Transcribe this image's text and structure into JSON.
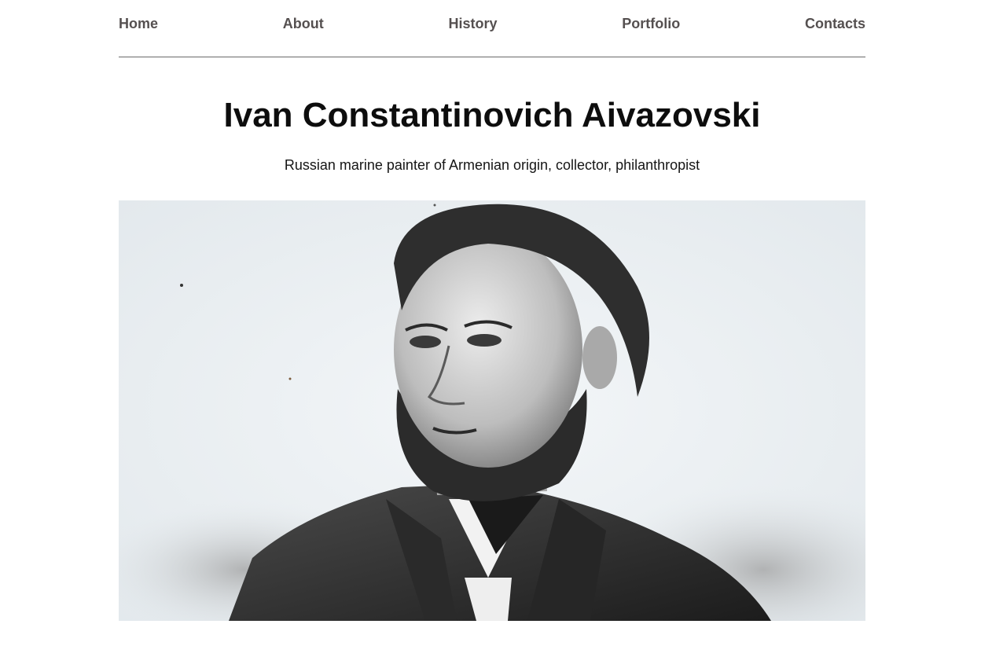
{
  "nav": {
    "items": [
      {
        "label": "Home"
      },
      {
        "label": "About"
      },
      {
        "label": "History"
      },
      {
        "label": "Portfolio"
      },
      {
        "label": "Contacts"
      }
    ]
  },
  "hero": {
    "title": "Ivan Constantinovich Aivazovski",
    "subtitle": "Russian marine painter of Armenian origin, collector, philanthropist"
  },
  "colors": {
    "nav_text": "#555050",
    "divider": "#6a6a6a",
    "title_text": "#0d0d0d",
    "photo_background": "#e9eef1"
  }
}
